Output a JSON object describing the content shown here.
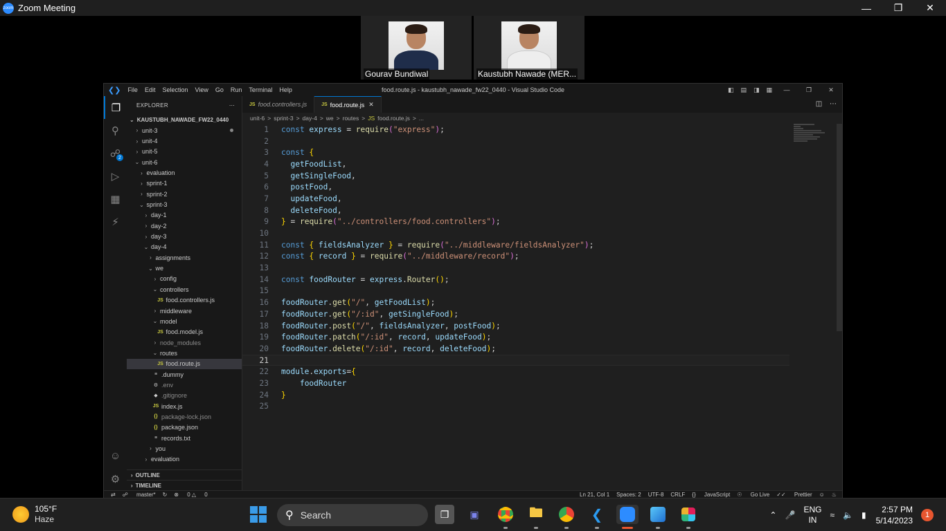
{
  "zoom": {
    "title": "Zoom Meeting",
    "logo_text": "zoom",
    "participants": [
      {
        "name": "Gourav Bundiwal"
      },
      {
        "name": "Kaustubh Nawade (MER..."
      }
    ]
  },
  "vscode": {
    "window_title": "food.route.js - kaustubh_nawade_fw22_0440 - Visual Studio Code",
    "menu": [
      "File",
      "Edit",
      "Selection",
      "View",
      "Go",
      "Run",
      "Terminal",
      "Help"
    ],
    "source_control_badge": "2",
    "explorer": {
      "header": "EXPLORER",
      "root": "KAUSTUBH_NAWADE_FW22_0440",
      "items": [
        {
          "label": "unit-3",
          "depth": 0,
          "type": "folder",
          "open": false,
          "modified": true
        },
        {
          "label": "unit-4",
          "depth": 0,
          "type": "folder",
          "open": false
        },
        {
          "label": "unit-5",
          "depth": 0,
          "type": "folder",
          "open": false
        },
        {
          "label": "unit-6",
          "depth": 0,
          "type": "folder",
          "open": true
        },
        {
          "label": "evaluation",
          "depth": 1,
          "type": "folder",
          "open": false
        },
        {
          "label": "sprint-1",
          "depth": 1,
          "type": "folder",
          "open": false
        },
        {
          "label": "sprint-2",
          "depth": 1,
          "type": "folder",
          "open": false
        },
        {
          "label": "sprint-3",
          "depth": 1,
          "type": "folder",
          "open": true
        },
        {
          "label": "day-1",
          "depth": 2,
          "type": "folder",
          "open": false
        },
        {
          "label": "day-2",
          "depth": 2,
          "type": "folder",
          "open": false
        },
        {
          "label": "day-3",
          "depth": 2,
          "type": "folder",
          "open": false
        },
        {
          "label": "day-4",
          "depth": 2,
          "type": "folder",
          "open": true
        },
        {
          "label": "assignments",
          "depth": 3,
          "type": "folder",
          "open": false
        },
        {
          "label": "we",
          "depth": 3,
          "type": "folder",
          "open": true
        },
        {
          "label": "config",
          "depth": 4,
          "type": "folder",
          "open": false
        },
        {
          "label": "controllers",
          "depth": 4,
          "type": "folder",
          "open": true
        },
        {
          "label": "food.controllers.js",
          "depth": 5,
          "type": "js"
        },
        {
          "label": "middleware",
          "depth": 4,
          "type": "folder",
          "open": false
        },
        {
          "label": "model",
          "depth": 4,
          "type": "folder",
          "open": true
        },
        {
          "label": "food.model.js",
          "depth": 5,
          "type": "js"
        },
        {
          "label": "node_modules",
          "depth": 4,
          "type": "folder",
          "open": false,
          "dim": true
        },
        {
          "label": "routes",
          "depth": 4,
          "type": "folder",
          "open": true
        },
        {
          "label": "food.route.js",
          "depth": 5,
          "type": "js",
          "selected": true
        },
        {
          "label": ".dummy",
          "depth": 4,
          "type": "text"
        },
        {
          "label": ".env",
          "depth": 4,
          "type": "gear",
          "dim": true
        },
        {
          "label": ".gitignore",
          "depth": 4,
          "type": "git",
          "dim": true
        },
        {
          "label": "index.js",
          "depth": 4,
          "type": "js"
        },
        {
          "label": "package-lock.json",
          "depth": 4,
          "type": "json",
          "dim": true
        },
        {
          "label": "package.json",
          "depth": 4,
          "type": "json"
        },
        {
          "label": "records.txt",
          "depth": 4,
          "type": "text"
        },
        {
          "label": "you",
          "depth": 3,
          "type": "folder",
          "open": false
        },
        {
          "label": "evaluation",
          "depth": 2,
          "type": "folder",
          "open": false
        }
      ],
      "outline": "OUTLINE",
      "timeline": "TIMELINE"
    },
    "tabs": [
      {
        "label": "food.controllers.js",
        "active": false
      },
      {
        "label": "food.route.js",
        "active": true
      }
    ],
    "breadcrumb": [
      "unit-6",
      ">",
      "sprint-3",
      ">",
      "day-4",
      ">",
      "we",
      ">",
      "routes",
      ">",
      "JS",
      "food.route.js",
      ">",
      "..."
    ],
    "code_lines": [
      [
        [
          "k",
          "const "
        ],
        [
          "v",
          "express"
        ],
        [
          "o",
          " = "
        ],
        [
          "f",
          "require"
        ],
        [
          "b2",
          "("
        ],
        [
          "s",
          "\"express\""
        ],
        [
          "b2",
          ")"
        ],
        [
          "o",
          ";"
        ]
      ],
      [],
      [
        [
          "k",
          "const "
        ],
        [
          "b1",
          "{"
        ]
      ],
      [
        [
          "o",
          "  "
        ],
        [
          "v",
          "getFoodList"
        ],
        [
          "o",
          ","
        ]
      ],
      [
        [
          "o",
          "  "
        ],
        [
          "v",
          "getSingleFood"
        ],
        [
          "o",
          ","
        ]
      ],
      [
        [
          "o",
          "  "
        ],
        [
          "v",
          "postFood"
        ],
        [
          "o",
          ","
        ]
      ],
      [
        [
          "o",
          "  "
        ],
        [
          "v",
          "updateFood"
        ],
        [
          "o",
          ","
        ]
      ],
      [
        [
          "o",
          "  "
        ],
        [
          "v",
          "deleteFood"
        ],
        [
          "o",
          ","
        ]
      ],
      [
        [
          "b1",
          "}"
        ],
        [
          "o",
          " = "
        ],
        [
          "f",
          "require"
        ],
        [
          "b2",
          "("
        ],
        [
          "s",
          "\"../controllers/food.controllers\""
        ],
        [
          "b2",
          ")"
        ],
        [
          "o",
          ";"
        ]
      ],
      [],
      [
        [
          "k",
          "const "
        ],
        [
          "b1",
          "{ "
        ],
        [
          "v",
          "fieldsAnalyzer"
        ],
        [
          "b1",
          " }"
        ],
        [
          "o",
          " = "
        ],
        [
          "f",
          "require"
        ],
        [
          "b2",
          "("
        ],
        [
          "s",
          "\"../middleware/fieldsAnalyzer\""
        ],
        [
          "b2",
          ")"
        ],
        [
          "o",
          ";"
        ]
      ],
      [
        [
          "k",
          "const "
        ],
        [
          "b1",
          "{ "
        ],
        [
          "v",
          "record"
        ],
        [
          "b1",
          " }"
        ],
        [
          "o",
          " = "
        ],
        [
          "f",
          "require"
        ],
        [
          "b2",
          "("
        ],
        [
          "s",
          "\"../middleware/record\""
        ],
        [
          "b2",
          ")"
        ],
        [
          "o",
          ";"
        ]
      ],
      [],
      [
        [
          "k",
          "const "
        ],
        [
          "v",
          "foodRouter"
        ],
        [
          "o",
          " = "
        ],
        [
          "v",
          "express"
        ],
        [
          "o",
          "."
        ],
        [
          "f",
          "Router"
        ],
        [
          "b1",
          "()"
        ],
        [
          "o",
          ";"
        ]
      ],
      [],
      [
        [
          "v",
          "foodRouter"
        ],
        [
          "o",
          "."
        ],
        [
          "f",
          "get"
        ],
        [
          "b1",
          "("
        ],
        [
          "s",
          "\"/\""
        ],
        [
          "o",
          ", "
        ],
        [
          "v",
          "getFoodList"
        ],
        [
          "b1",
          ")"
        ],
        [
          "o",
          ";"
        ]
      ],
      [
        [
          "v",
          "foodRouter"
        ],
        [
          "o",
          "."
        ],
        [
          "f",
          "get"
        ],
        [
          "b1",
          "("
        ],
        [
          "s",
          "\"/:id\""
        ],
        [
          "o",
          ", "
        ],
        [
          "v",
          "getSingleFood"
        ],
        [
          "b1",
          ")"
        ],
        [
          "o",
          ";"
        ]
      ],
      [
        [
          "v",
          "foodRouter"
        ],
        [
          "o",
          "."
        ],
        [
          "f",
          "post"
        ],
        [
          "b1",
          "("
        ],
        [
          "s",
          "\"/\""
        ],
        [
          "o",
          ", "
        ],
        [
          "v",
          "fieldsAnalyzer"
        ],
        [
          "o",
          ", "
        ],
        [
          "v",
          "postFood"
        ],
        [
          "b1",
          ")"
        ],
        [
          "o",
          ";"
        ]
      ],
      [
        [
          "v",
          "foodRouter"
        ],
        [
          "o",
          "."
        ],
        [
          "f",
          "patch"
        ],
        [
          "b1",
          "("
        ],
        [
          "s",
          "\"/:id\""
        ],
        [
          "o",
          ", "
        ],
        [
          "v",
          "record"
        ],
        [
          "o",
          ", "
        ],
        [
          "v",
          "updateFood"
        ],
        [
          "b1",
          ")"
        ],
        [
          "o",
          ";"
        ]
      ],
      [
        [
          "v",
          "foodRouter"
        ],
        [
          "o",
          "."
        ],
        [
          "f",
          "delete"
        ],
        [
          "b1",
          "("
        ],
        [
          "s",
          "\"/:id\""
        ],
        [
          "o",
          ", "
        ],
        [
          "v",
          "record"
        ],
        [
          "o",
          ", "
        ],
        [
          "v",
          "deleteFood"
        ],
        [
          "b1",
          ")"
        ],
        [
          "o",
          ";"
        ]
      ],
      [],
      [
        [
          "v",
          "module"
        ],
        [
          "o",
          "."
        ],
        [
          "v",
          "exports"
        ],
        [
          "o",
          "="
        ],
        [
          "b1",
          "{"
        ]
      ],
      [
        [
          "o",
          "    "
        ],
        [
          "v",
          "foodRouter"
        ]
      ],
      [
        [
          "b1",
          "}"
        ]
      ],
      []
    ],
    "current_line": 21,
    "status": {
      "branch": "master*",
      "errors": "0",
      "warnings": "0",
      "position": "Ln 21, Col 1",
      "spaces": "Spaces: 2",
      "encoding": "UTF-8",
      "eol": "CRLF",
      "language": "JavaScript",
      "golive": "Go Live",
      "prettier": "Prettier"
    }
  },
  "taskbar": {
    "weather_temp": "105°F",
    "weather_cond": "Haze",
    "search_label": "Search",
    "lang_line1": "ENG",
    "lang_line2": "IN",
    "time": "2:57 PM",
    "date": "5/14/2023",
    "notifications": "1"
  }
}
